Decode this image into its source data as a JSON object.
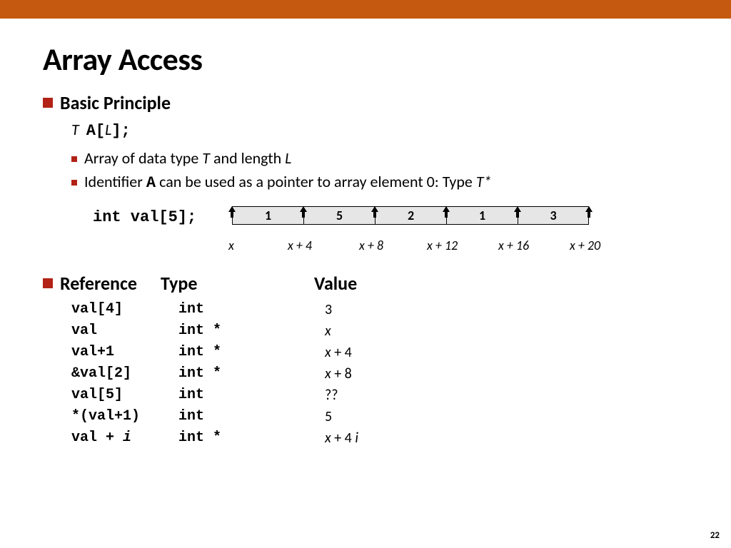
{
  "title": "Array Access",
  "basic_heading": "Basic Principle",
  "decl_T": "T",
  "decl_A_open": "A[",
  "decl_L": "L",
  "decl_close": "];",
  "bullets": {
    "b1_pre": "Array of data type ",
    "b1_T": "T",
    "b1_mid": " and length ",
    "b1_L": "L",
    "b2_pre": "Identifier ",
    "b2_A": "A",
    "b2_mid": " can be used as a pointer to array element 0: Type ",
    "b2_Tstar": "T*"
  },
  "int_decl": "int val[5];",
  "cells": [
    "1",
    "5",
    "2",
    "1",
    "3"
  ],
  "addrs": [
    "x",
    "x + 4",
    "x + 8",
    "x + 12",
    "x + 16",
    "x + 20"
  ],
  "cols": {
    "ref": "Reference",
    "type": "Type",
    "val": "Value"
  },
  "rows": [
    {
      "ref": "val[4]",
      "type": "int",
      "val_plain": "3"
    },
    {
      "ref": "val",
      "type": "int *",
      "val_x": "x"
    },
    {
      "ref": "val+1",
      "type": "int *",
      "val_x": "x",
      "val_tail": " + 4"
    },
    {
      "ref": "&val[2]",
      "type": "int *",
      "val_x": "x",
      "val_tail": " + 8"
    },
    {
      "ref": "val[5]",
      "type": "int",
      "val_plain": "??"
    },
    {
      "ref": "*(val+1)",
      "type": "int",
      "val_plain": "5"
    },
    {
      "ref_pre": "val + ",
      "ref_it": "i",
      "type": "int *",
      "val_x": "x",
      "val_tail2": " + 4 ",
      "val_i": "i"
    }
  ],
  "page": "22"
}
